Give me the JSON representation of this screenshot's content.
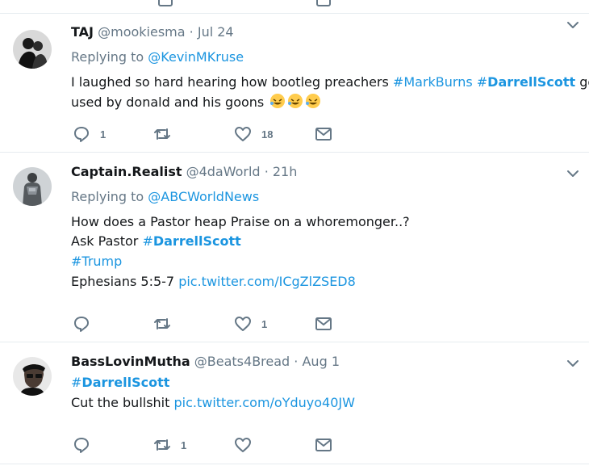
{
  "tweets": [
    {
      "name": "TAJ",
      "handle": "@mookiesma",
      "dot": "·",
      "time": "Jul 24",
      "replying_label": "Replying to",
      "replying_to": "@KevinMKruse",
      "text": {
        "l1_a": "I laughed so hard hearing how bootleg preachers ",
        "l1_tag1": "#MarkBurns",
        "l1_sp": " ",
        "l1_tag2_hash": "#",
        "l1_tag2": "DarrellScott",
        "l1_b": " got",
        "l2": "used by donald and his goons"
      },
      "emoji": [
        "rolling-on-floor-laughing",
        "rolling-on-floor-laughing",
        "rolling-on-floor-laughing"
      ],
      "replies": "1",
      "retweets": "",
      "likes": "18"
    },
    {
      "name": "Captain.Realist",
      "handle": "@4daWorld",
      "dot": "·",
      "time": "21h",
      "replying_label": "Replying to",
      "replying_to": "@ABCWorldNews",
      "text": {
        "l1": "How does a Pastor heap Praise on a whoremonger..?",
        "l2_a": "Ask Pastor ",
        "l2_hash": "#",
        "l2_tag": "DarrellScott",
        "l3": "#Trump",
        "l4_a": "Ephesians 5:5-7 ",
        "l4_link": "pic.twitter.com/ICgZlZSED8"
      },
      "replies": "",
      "retweets": "",
      "likes": "1"
    },
    {
      "name": "BassLovinMutha",
      "handle": "@Beats4Bread",
      "dot": "·",
      "time": "Aug 1",
      "text": {
        "l1_hash": "#",
        "l1_tag": "DarrellScott",
        "l2_a": "Cut the bullshit ",
        "l2_link": "pic.twitter.com/oYduyo40JW"
      },
      "replies": "",
      "retweets": "1",
      "likes": ""
    }
  ],
  "icons": {
    "reply": "reply-icon",
    "retweet": "retweet-icon",
    "like": "heart-icon",
    "dm": "envelope-icon",
    "caret": "chevron-down-icon"
  },
  "colors": {
    "text": "#14171a",
    "secondary": "#657786",
    "link": "#1b95e0",
    "divider": "#e6ecf0"
  }
}
